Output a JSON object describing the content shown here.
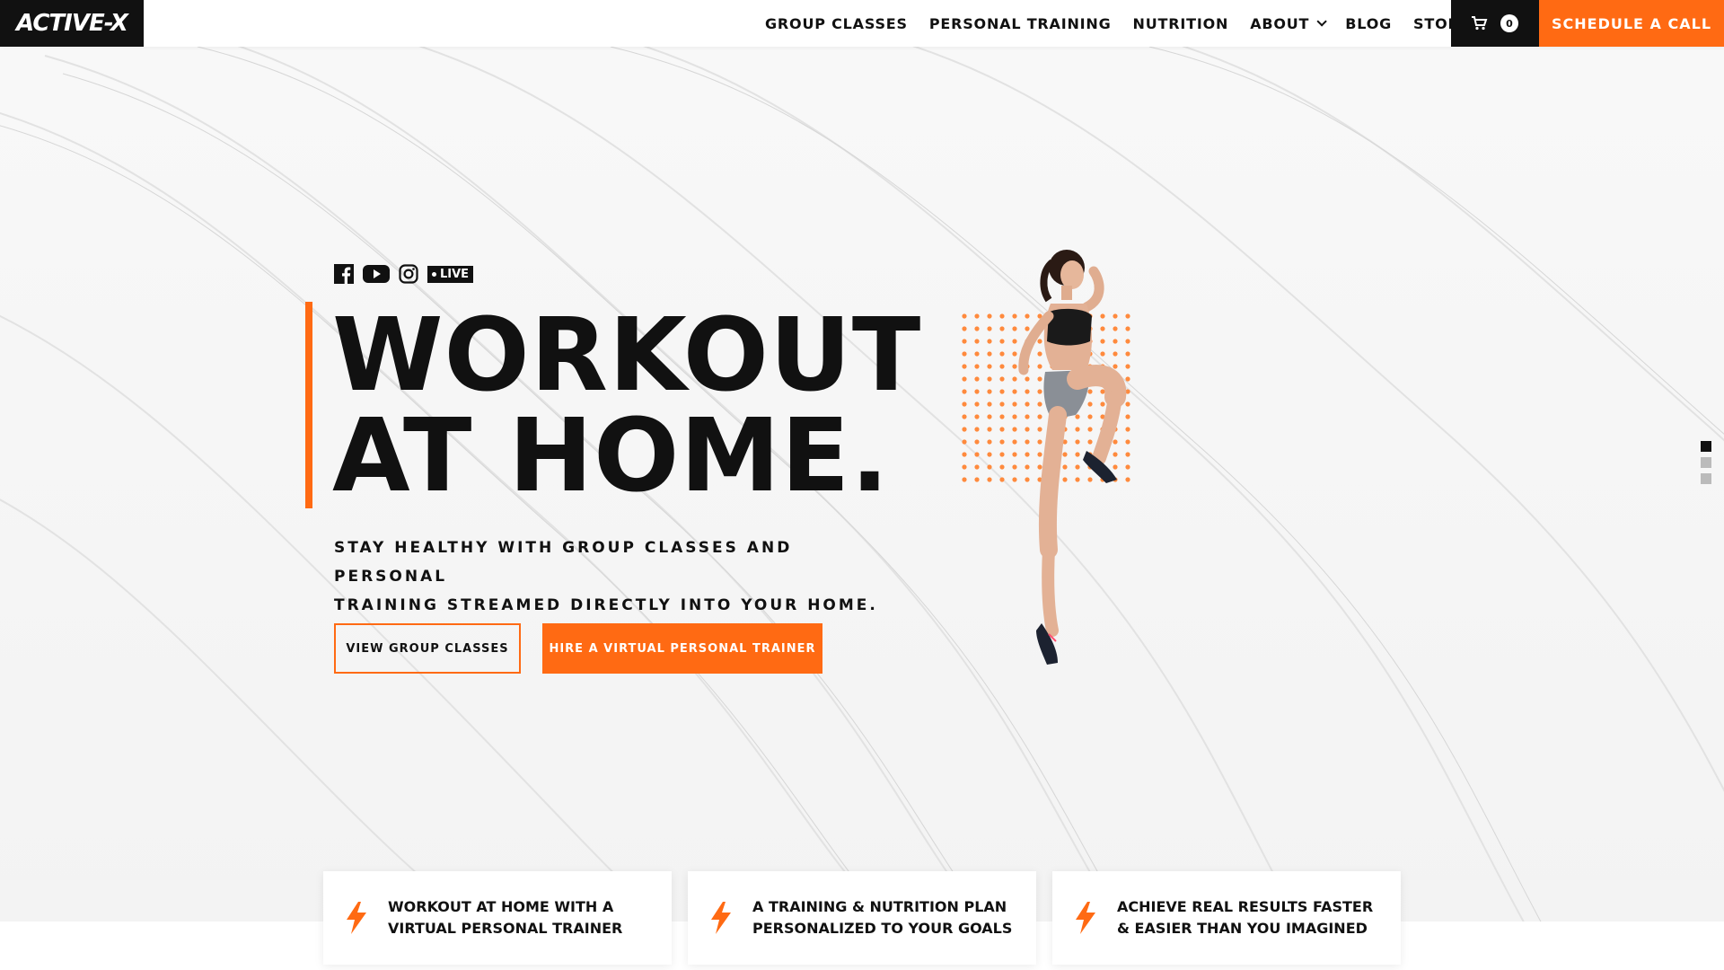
{
  "brand": {
    "logo_text": "ACTIVE-X"
  },
  "nav": {
    "items": [
      {
        "label": "GROUP CLASSES"
      },
      {
        "label": "PERSONAL TRAINING"
      },
      {
        "label": "NUTRITION"
      },
      {
        "label": "ABOUT"
      },
      {
        "label": "BLOG"
      },
      {
        "label": "STORE"
      }
    ],
    "cart_count": "0",
    "cta_label": "SCHEDULE A CALL"
  },
  "hero": {
    "social_icons": [
      "facebook-icon",
      "youtube-icon",
      "instagram-icon"
    ],
    "live_label": "LIVE",
    "headline_line1": "WORKOUT",
    "headline_line2": "AT HOME.",
    "subhead_line1": "STAY HEALTHY WITH GROUP CLASSES AND PERSONAL",
    "subhead_line2": "TRAINING STREAMED DIRECTLY INTO YOUR HOME.",
    "btn_outline": "VIEW GROUP CLASSES",
    "btn_solid": "HIRE A VIRTUAL PERSONAL TRAINER"
  },
  "features": [
    {
      "line1": "WORKOUT AT HOME WITH A",
      "line2": "VIRTUAL PERSONAL TRAINER"
    },
    {
      "line1": "A TRAINING & NUTRITION PLAN",
      "line2": "PERSONALIZED TO YOUR GOALS"
    },
    {
      "line1": "ACHIEVE REAL RESULTS FASTER",
      "line2": "& EASIER THAN YOU IMAGINED"
    }
  ],
  "colors": {
    "accent": "#ff6a13",
    "dark": "#111111"
  }
}
